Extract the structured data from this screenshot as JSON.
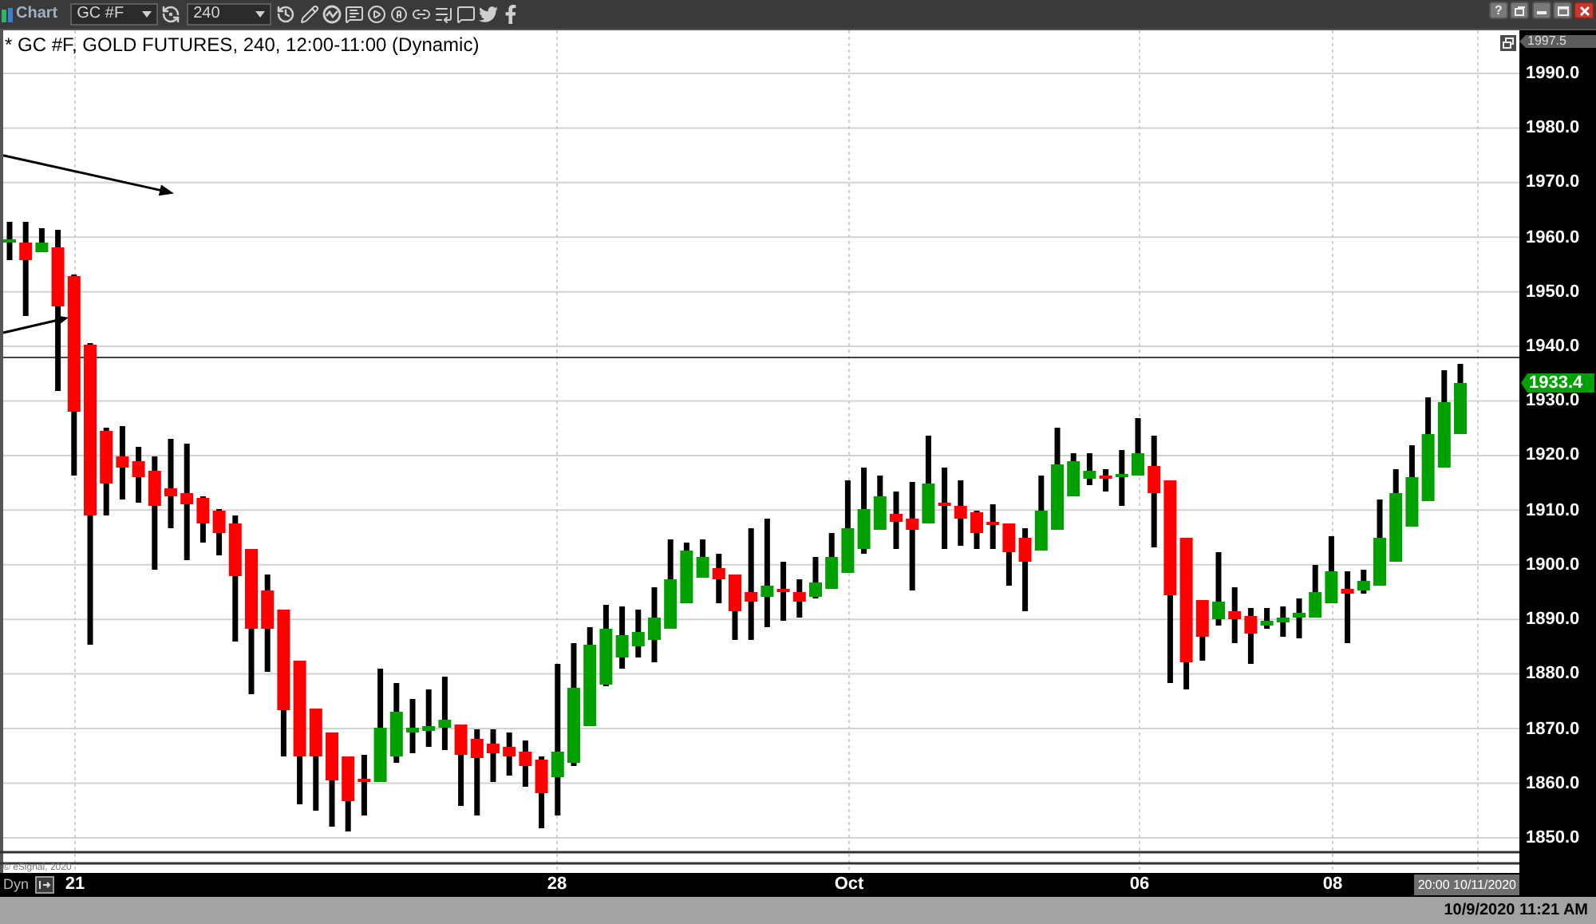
{
  "toolbar": {
    "app_title": "Chart",
    "symbol": "GC #F",
    "interval": "240"
  },
  "window_controls": {
    "help": "?"
  },
  "chart": {
    "title": "* GC #F, GOLD FUTURES, 240, 12:00-11:00 (Dynamic)",
    "copyright": "© eSignal, 2020"
  },
  "price_axis": {
    "top_marker": "1997.5",
    "ticks": [
      "1990.0",
      "1980.0",
      "1970.0",
      "1960.0",
      "1950.0",
      "1940.0",
      "1930.0",
      "1920.0",
      "1910.0",
      "1900.0",
      "1890.0",
      "1880.0",
      "1870.0",
      "1860.0",
      "1850.0"
    ],
    "last_price": "1933.4"
  },
  "time_axis": {
    "mode": "Dyn",
    "ticks": [
      "21",
      "28",
      "Oct",
      "06",
      "08"
    ],
    "cursor_time": "20:00 10/11/2020"
  },
  "status_bar": {
    "datetime": "10/9/2020 11:21 AM"
  }
}
